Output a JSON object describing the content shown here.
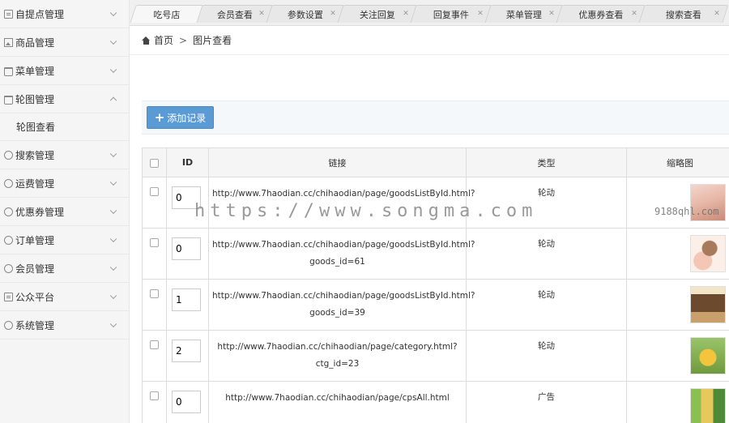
{
  "sidebar": {
    "items": [
      {
        "label": "自提点管理",
        "icon": "document-icon",
        "expanded": false
      },
      {
        "label": "商品管理",
        "icon": "image-icon",
        "expanded": false
      },
      {
        "label": "菜单管理",
        "icon": "bag-icon",
        "expanded": false
      },
      {
        "label": "轮图管理",
        "icon": "bag-icon",
        "expanded": true
      },
      {
        "label": "搜索管理",
        "icon": "chat-icon",
        "expanded": false
      },
      {
        "label": "运费管理",
        "icon": "chat-icon",
        "expanded": false
      },
      {
        "label": "优惠券管理",
        "icon": "chat-icon",
        "expanded": false
      },
      {
        "label": "订单管理",
        "icon": "chat-icon",
        "expanded": false
      },
      {
        "label": "会员管理",
        "icon": "chat-icon",
        "expanded": false
      },
      {
        "label": "公众平台",
        "icon": "document-icon",
        "expanded": false
      },
      {
        "label": "系统管理",
        "icon": "chat-icon",
        "expanded": false
      }
    ],
    "sub_item": "轮图查看"
  },
  "tabs": [
    {
      "label": "吃号店"
    },
    {
      "label": "会员查看"
    },
    {
      "label": "参数设置"
    },
    {
      "label": "关注回复"
    },
    {
      "label": "回复事件"
    },
    {
      "label": "菜单管理"
    },
    {
      "label": "优惠券查看"
    },
    {
      "label": "搜索查看"
    }
  ],
  "breadcrumb": {
    "home": "首页",
    "separator": ">",
    "current": "图片查看"
  },
  "toolbar": {
    "add_label": "添加记录"
  },
  "table": {
    "headers": {
      "id": "ID",
      "link": "链接",
      "type": "类型",
      "thumb": "缩略图"
    },
    "rows": [
      {
        "id": "0",
        "link": "http://www.7haodian.cc/chihaodian/page/goodsListById.html?",
        "type": "轮动"
      },
      {
        "id": "0",
        "link": "http://www.7haodian.cc/chihaodian/page/goodsListById.html?goods_id=61",
        "type": "轮动"
      },
      {
        "id": "1",
        "link": "http://www.7haodian.cc/chihaodian/page/goodsListById.html?goods_id=39",
        "type": "轮动"
      },
      {
        "id": "2",
        "link": "http://www.7haodian.cc/chihaodian/page/category.html?ctg_id=23",
        "type": "轮动"
      },
      {
        "id": "0",
        "link": "http://www.7haodian.cc/chihaodian/page/cpsAll.html",
        "type": "广告"
      }
    ]
  },
  "watermark": {
    "main": "https://www.songma.com",
    "side": "9188qhl.com"
  }
}
